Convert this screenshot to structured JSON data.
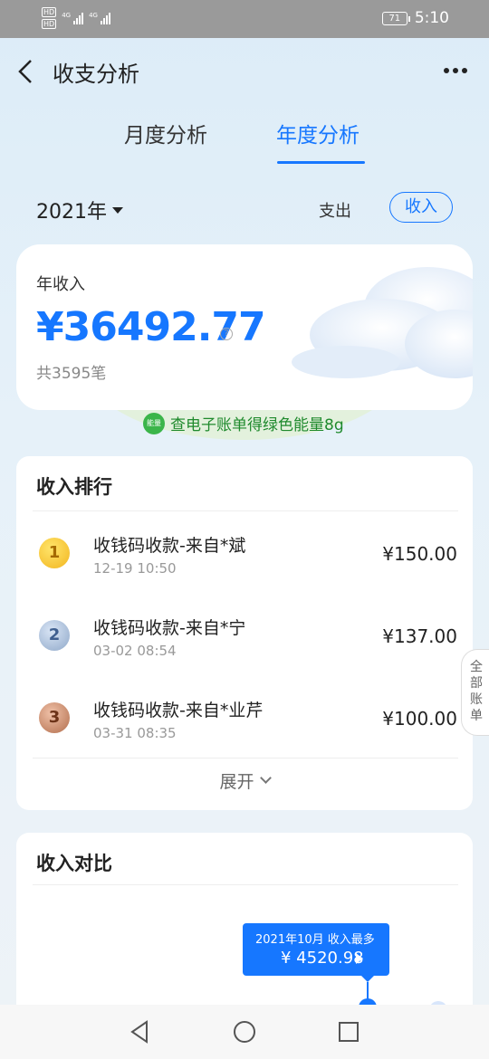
{
  "status_bar": {
    "battery": "71",
    "time": "5:10",
    "hd_top": "HD",
    "hd_bottom": "HD",
    "network_1": "4G",
    "network_2": "4G"
  },
  "header": {
    "title": "收支分析"
  },
  "tabs": [
    {
      "label": "月度分析",
      "active": false
    },
    {
      "label": "年度分析",
      "active": true
    }
  ],
  "filter": {
    "year": "2021年",
    "expense_label": "支出",
    "income_label": "收入",
    "selected": "收入"
  },
  "summary": {
    "label": "年收入",
    "amount": "¥36492.77",
    "help": "?",
    "count": "共3595笔"
  },
  "energy": {
    "badge": "能量",
    "text": "查电子账单得绿色能量8g"
  },
  "ranking": {
    "title": "收入排行",
    "items": [
      {
        "rank": "1",
        "name": "收钱码收款-来自*斌",
        "time": "12-19 10:50",
        "amount": "¥150.00"
      },
      {
        "rank": "2",
        "name": "收钱码收款-来自*宁",
        "time": "03-02 08:54",
        "amount": "¥137.00"
      },
      {
        "rank": "3",
        "name": "收钱码收款-来自*业芹",
        "time": "03-31 08:35",
        "amount": "¥100.00"
      }
    ],
    "expand_label": "展开"
  },
  "side_tab": {
    "label": "全部账单"
  },
  "compare": {
    "title": "收入对比",
    "tooltip_title": "2021年10月 收入最多",
    "tooltip_value": "¥ 4520.98"
  },
  "colors": {
    "accent": "#1677ff",
    "green": "#1f8a2d"
  }
}
